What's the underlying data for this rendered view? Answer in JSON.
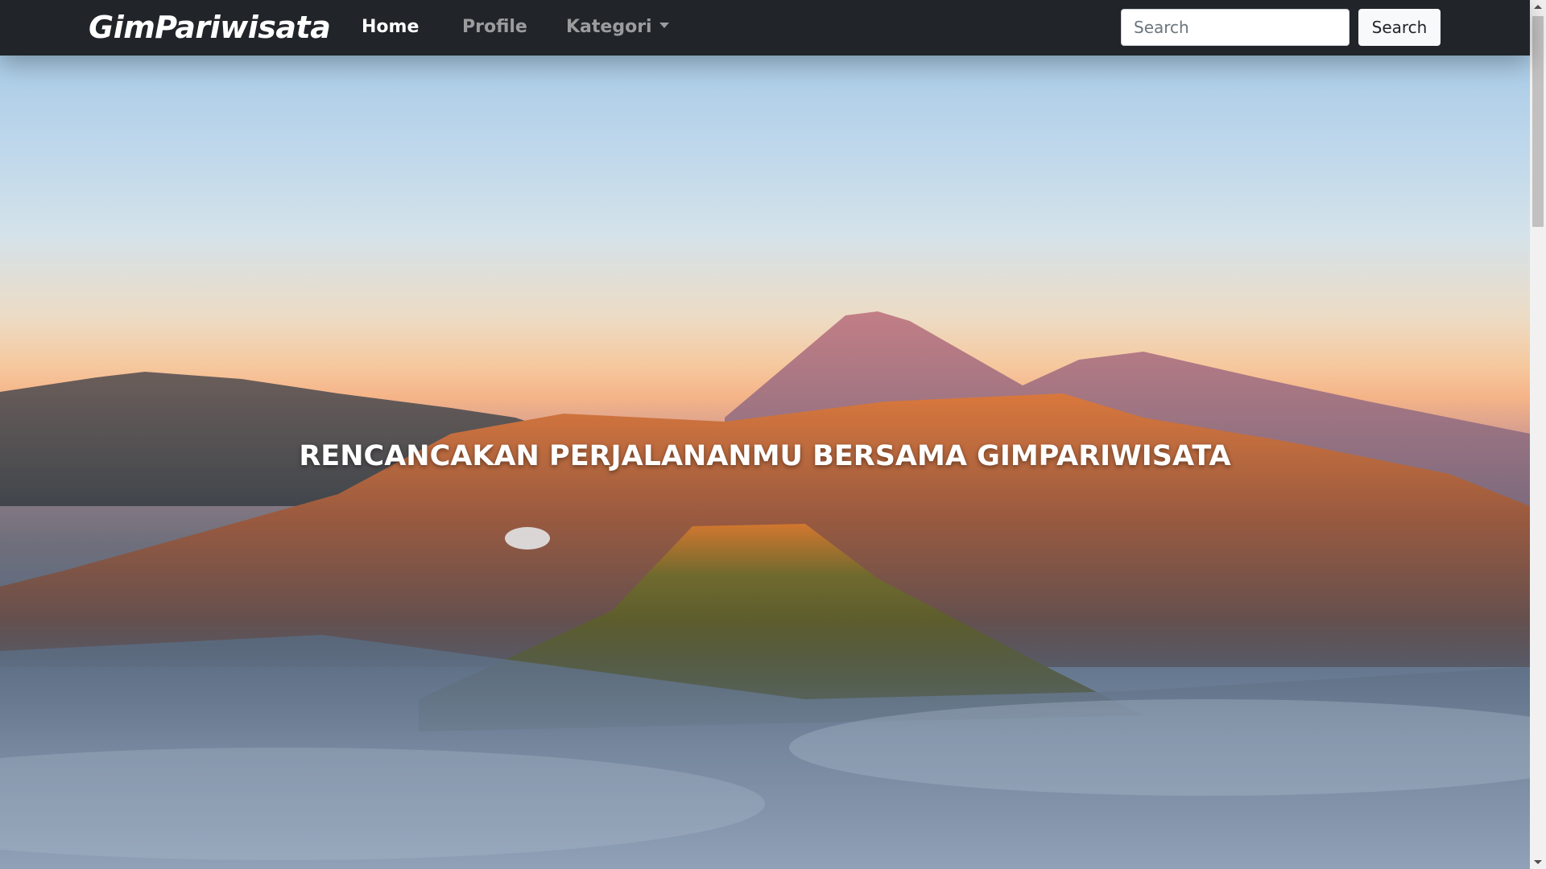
{
  "navbar": {
    "brand": "GimPariwisata",
    "links": [
      {
        "label": "Home",
        "active": true
      },
      {
        "label": "Profile",
        "active": false
      },
      {
        "label": "Kategori",
        "active": false,
        "dropdown": true
      }
    ],
    "search": {
      "placeholder": "Search",
      "value": "",
      "button_label": "Search"
    }
  },
  "hero": {
    "title": "RENCANCAKAN PERJALANANMU BERSAMA GIMPARIWISATA",
    "background": "volcano-landscape-image"
  },
  "colors": {
    "navbar_bg": "#212529",
    "link_active": "#ffffff",
    "link_muted": "rgba(255,255,255,0.55)",
    "search_button_bg": "#f8f9fa"
  }
}
